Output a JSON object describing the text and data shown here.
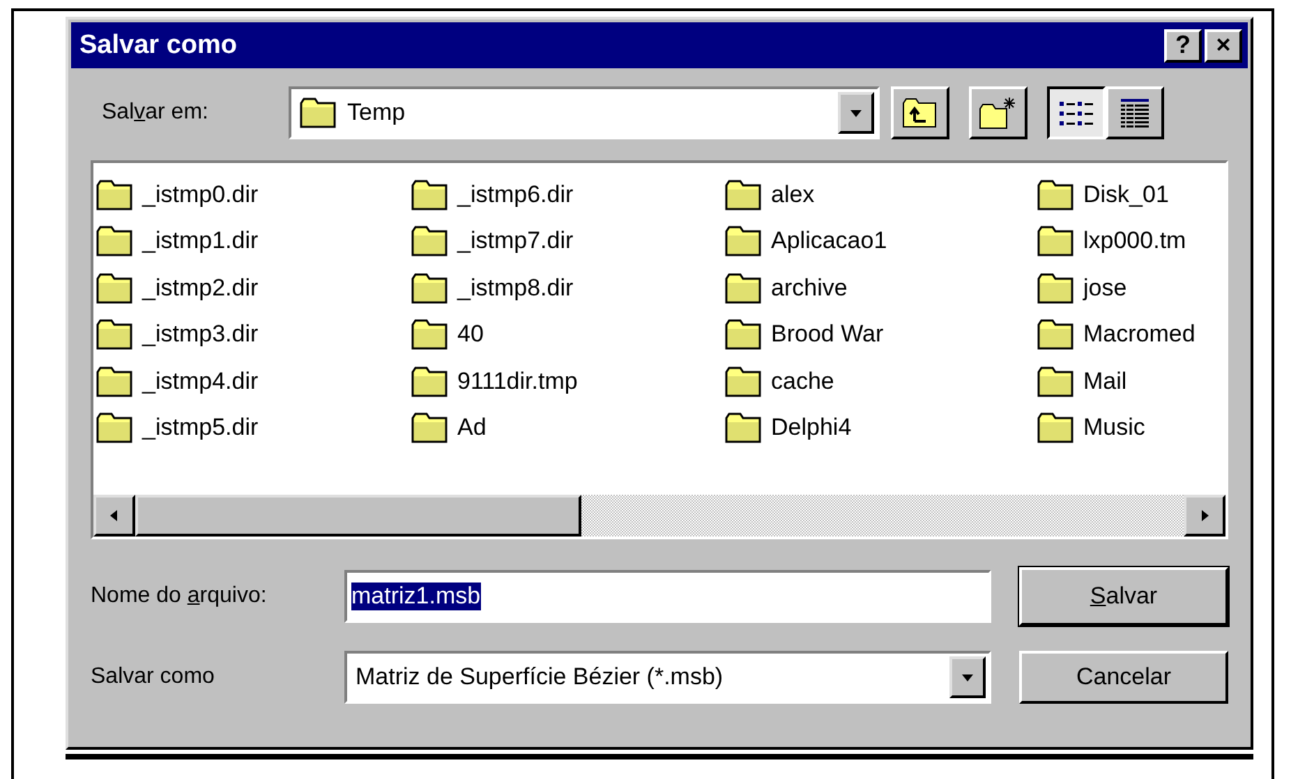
{
  "window": {
    "title": "Salvar como",
    "title_buttons": [
      "?",
      "×"
    ]
  },
  "location": {
    "label_parts": [
      "Sal",
      "v",
      "ar em:"
    ],
    "value": "Temp"
  },
  "toolbar": [
    {
      "kind": "up-folder"
    },
    {
      "kind": "new-folder"
    }
  ],
  "views": [
    {
      "kind": "list",
      "selected": true
    },
    {
      "kind": "details",
      "selected": false
    }
  ],
  "files": [
    [
      "_istmp0.dir",
      "_istmp1.dir",
      "_istmp2.dir",
      "_istmp3.dir",
      "_istmp4.dir",
      "_istmp5.dir"
    ],
    [
      "_istmp6.dir",
      "_istmp7.dir",
      "_istmp8.dir",
      "40",
      "9111dir.tmp",
      "Ad"
    ],
    [
      "alex",
      "Aplicacao1",
      "archive",
      "Brood War",
      "cache",
      "Delphi4"
    ],
    [
      "Disk_01",
      "lxp000.tm",
      "jose",
      "Macromed",
      "Mail",
      "Music"
    ]
  ],
  "file_name": {
    "label_parts": [
      "Nome do ",
      "a",
      "rquivo:"
    ],
    "value": "matriz1.msb",
    "text_selected": true
  },
  "file_type": {
    "label": "Salvar como",
    "value": "Matriz de Superfície Bézier (*.msb)"
  },
  "buttons": [
    {
      "label_parts": {
        "key": "S",
        "after": "alvar"
      },
      "default": true
    },
    {
      "label_parts": {
        "before": "Cancelar"
      },
      "default": false
    }
  ]
}
